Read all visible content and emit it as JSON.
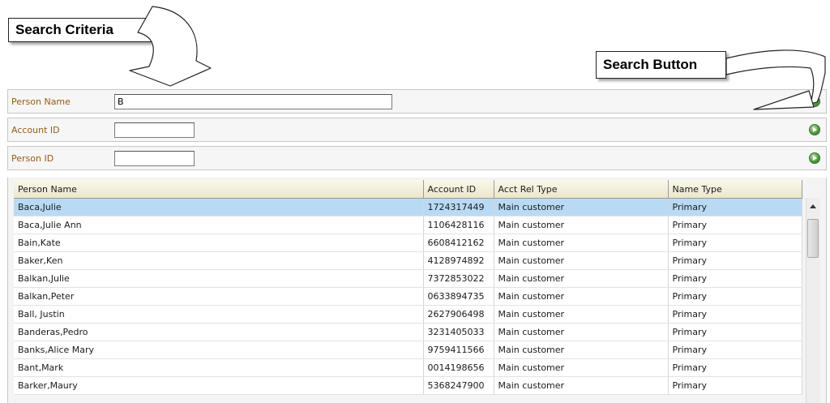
{
  "callouts": {
    "search_criteria": "Search Criteria",
    "search_button": "Search Button"
  },
  "search_fields": [
    {
      "label": "Person Name",
      "value": "B"
    },
    {
      "label": "Account ID",
      "value": ""
    },
    {
      "label": "Person ID",
      "value": ""
    }
  ],
  "grid": {
    "columns": [
      "Person Name",
      "Account ID",
      "Acct Rel Type",
      "Name Type"
    ],
    "rows": [
      [
        "Baca,Julie",
        "1724317449",
        "Main customer",
        "Primary"
      ],
      [
        "Baca,Julie Ann",
        "1106428116",
        "Main customer",
        "Primary"
      ],
      [
        "Bain,Kate",
        "6608412162",
        "Main customer",
        "Primary"
      ],
      [
        "Baker,Ken",
        "4128974892",
        "Main customer",
        "Primary"
      ],
      [
        "Balkan,Julie",
        "7372853022",
        "Main customer",
        "Primary"
      ],
      [
        "Balkan,Peter",
        "0633894735",
        "Main customer",
        "Primary"
      ],
      [
        "Ball, Justin",
        "2627906498",
        "Main customer",
        "Primary"
      ],
      [
        "Banderas,Pedro",
        "3231405033",
        "Main customer",
        "Primary"
      ],
      [
        "Banks,Alice Mary",
        "9759411566",
        "Main customer",
        "Primary"
      ],
      [
        "Bant,Mark",
        "0014198656",
        "Main customer",
        "Primary"
      ],
      [
        "Barker,Maury",
        "5368247900",
        "Main customer",
        "Primary"
      ]
    ],
    "selected_row": 0
  },
  "colors": {
    "label": "#9a5a10",
    "selected_row": "#b9daf5",
    "go_button": "#4f9d3a"
  }
}
